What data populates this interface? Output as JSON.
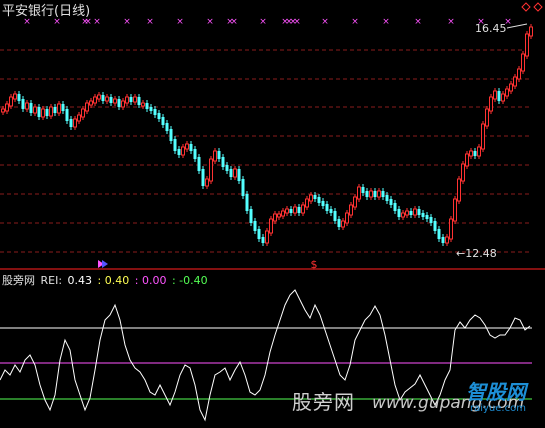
{
  "window": {
    "title": "平安银行(日线)"
  },
  "main_chart": {
    "high_label": "16.45",
    "low_label": "12.48",
    "signal_marker": "$",
    "marker_symbol": "×",
    "colors": {
      "up": "#ff3232",
      "down": "#54ffff",
      "grid": "#8a1c1c",
      "marker": "#ff54ff",
      "separator": "#b01616"
    }
  },
  "indicator": {
    "prefix": "股旁网",
    "name": "REI:",
    "values": [
      "0.43",
      ": 0.40",
      ": 0.00",
      ": -0.40"
    ],
    "value_colors": [
      "#ffffff",
      "#ffff54",
      "#ff54ff",
      "#54ff54"
    ],
    "line_colors": {
      "rei": "#ffffff",
      "upper": "#ffffff",
      "middle": "#ff54ff",
      "lower": "#54ff54"
    }
  },
  "watermark": {
    "text_cn": "股旁网",
    "text_url": "www.gupang.com",
    "logo_cn": "智股网",
    "logo_url": "raiyue.com"
  },
  "chart_data": {
    "type": "line",
    "title": "平安银行(日线)",
    "high": 16.45,
    "low": 12.48,
    "indicator_series": [
      {
        "name": "REI",
        "last": 0.43
      },
      {
        "name": "",
        "last": 0.4
      },
      {
        "name": "",
        "last": 0.0
      },
      {
        "name": "",
        "last": -0.4
      }
    ]
  }
}
